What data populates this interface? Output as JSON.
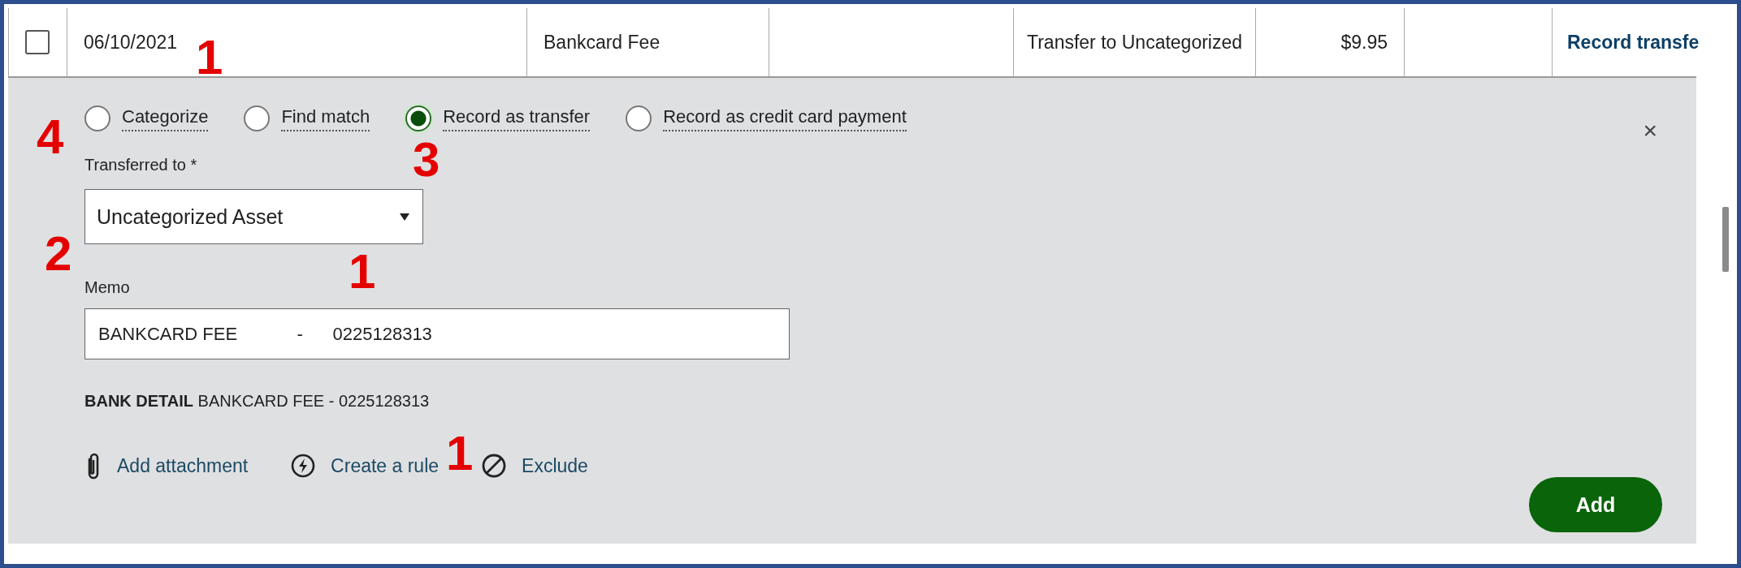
{
  "row": {
    "checked": false,
    "date": "06/10/2021",
    "description": "Bankcard Fee",
    "category": "Transfer to Uncategorized",
    "amount": "$9.95",
    "action": "Record transfe"
  },
  "panel": {
    "options": [
      {
        "label": "Categorize",
        "selected": false
      },
      {
        "label": "Find match",
        "selected": false
      },
      {
        "label": "Record as transfer",
        "selected": true
      },
      {
        "label": "Record as credit card payment",
        "selected": false
      }
    ],
    "close": "×",
    "transfer": {
      "label": "Transferred to *",
      "value": "Uncategorized Asset"
    },
    "memo": {
      "label": "Memo",
      "value": "BANKCARD FEE            -      0225128313"
    },
    "bank_detail": "**BANK DETAIL** BANKCARD FEE - 0225128313",
    "actions": [
      {
        "kind": "attachment",
        "label": "Add attachment"
      },
      {
        "kind": "rule",
        "label": "Create a rule"
      },
      {
        "kind": "exclude",
        "label": "Exclude"
      }
    ],
    "add_button": "Add"
  },
  "annotations": [
    {
      "text": "1"
    },
    {
      "text": "4"
    },
    {
      "text": "3"
    },
    {
      "text": "2"
    },
    {
      "text": "1"
    },
    {
      "text": "1"
    }
  ]
}
